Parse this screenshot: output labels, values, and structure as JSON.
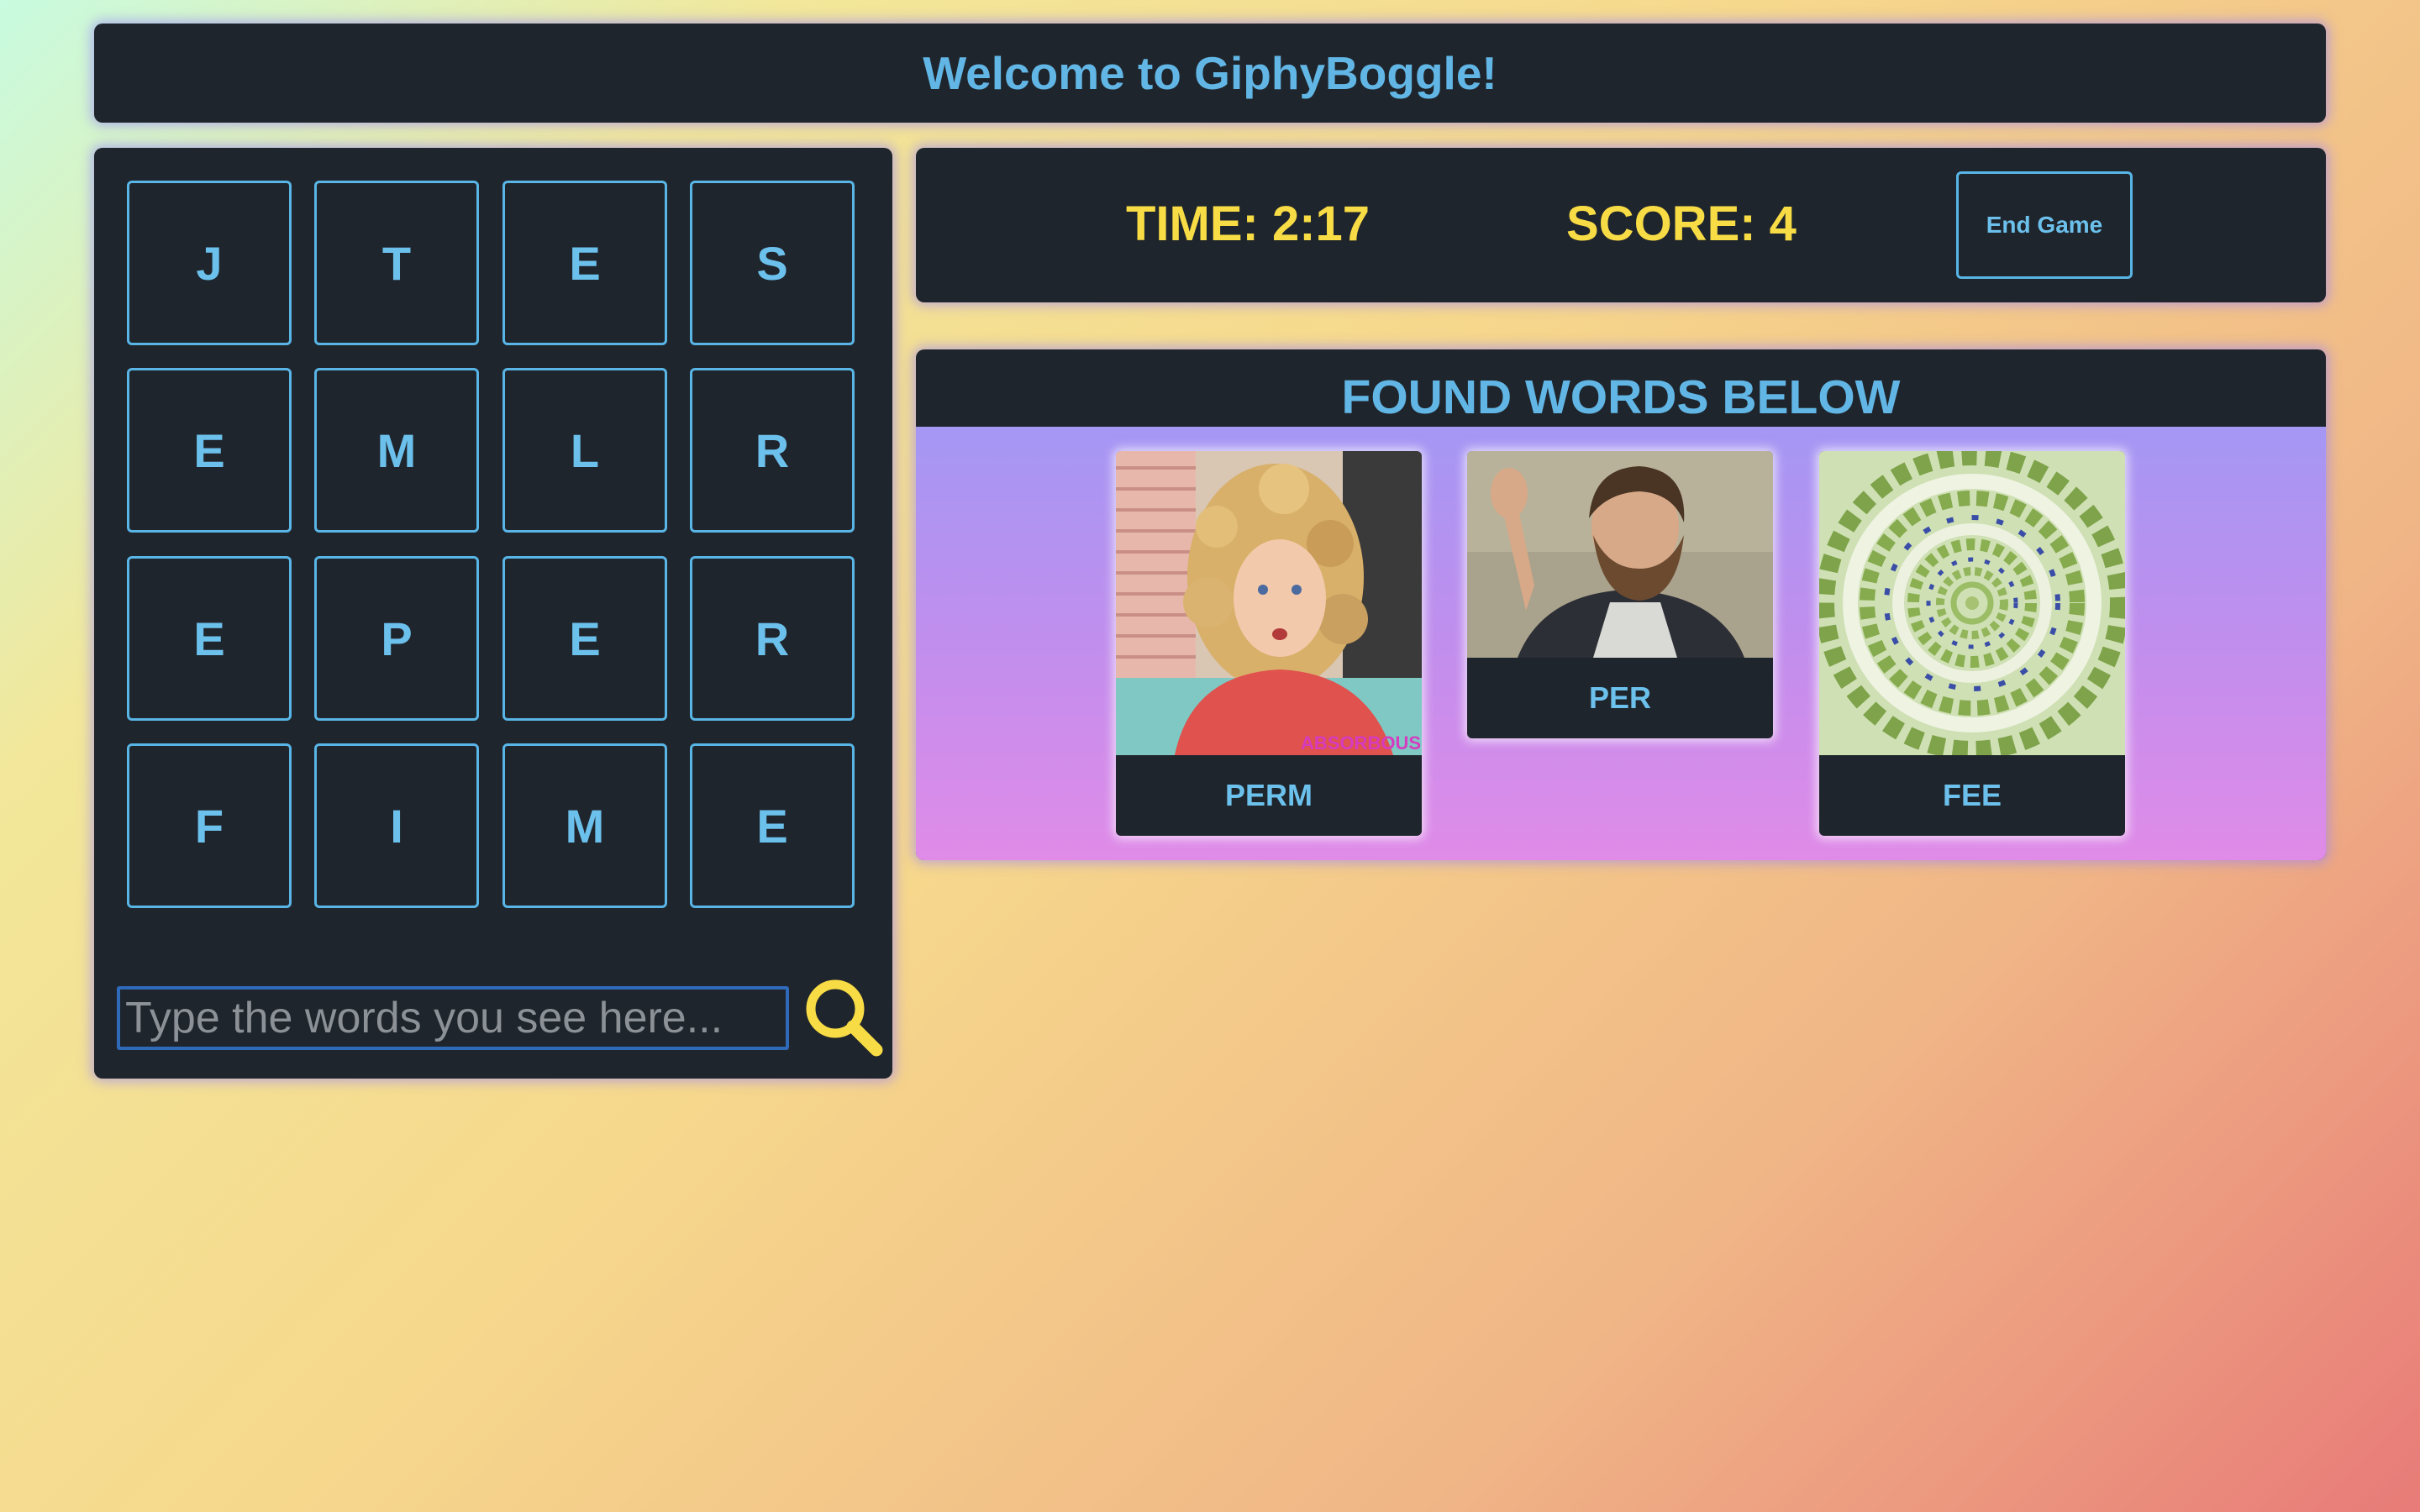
{
  "header": {
    "title": "Welcome to GiphyBoggle!"
  },
  "board": {
    "rows": [
      [
        "J",
        "T",
        "E",
        "S"
      ],
      [
        "E",
        "M",
        "L",
        "R"
      ],
      [
        "E",
        "P",
        "E",
        "R"
      ],
      [
        "F",
        "I",
        "M",
        "E"
      ]
    ],
    "input_placeholder": "Type the words you see here...",
    "search_icon": "magnifier-icon"
  },
  "status": {
    "time_text": "TIME: 2:17",
    "score_text": "SCORE: 4",
    "end_button_label": "End Game"
  },
  "found": {
    "title": "FOUND WORDS BELOW",
    "cards": [
      {
        "word": "PERM",
        "image": "woman-curly-hair-gif",
        "watermark": "ABSORBOUS"
      },
      {
        "word": "PER",
        "image": "bearded-man-waving-gif"
      },
      {
        "word": "FEE",
        "image": "money-spiral-gif"
      }
    ]
  },
  "colors": {
    "panel": "#1f252c",
    "accent_blue": "#62b6e6",
    "accent_yellow": "#f8dc45"
  }
}
